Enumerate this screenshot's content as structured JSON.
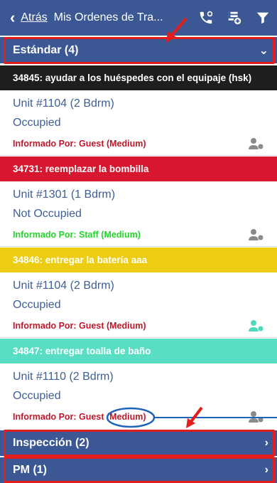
{
  "header": {
    "back_label": "Atrás",
    "title": "Mis Ordenes de Tra...",
    "icons": [
      "phone-icon",
      "add-list-icon",
      "filter-icon"
    ]
  },
  "sections": {
    "standard": {
      "label": "Estándar (4)"
    },
    "inspection": {
      "label": "Inspección (2)"
    },
    "pm": {
      "label": "PM (1)"
    }
  },
  "work_orders": [
    {
      "header": "34845: ayudar a los huéspedes con el equipaje (hsk)",
      "header_bg": "#1e1e1e",
      "header_color": "#ffffff",
      "unit": "Unit #1104 (2 Bdrm)",
      "status": "Occupied",
      "reported": "Informado Por: Guest  (Medium)",
      "reported_color": "#c0182a",
      "icon_color": "#8a8a8a"
    },
    {
      "header": "34731: reemplazar la bombilla",
      "header_bg": "#d7172f",
      "header_color": "#ffffff",
      "unit": "Unit #1301 (1 Bdrm)",
      "status": "Not Occupied",
      "reported": "Informado Por: Staff  (Medium)",
      "reported_color": "#22d42a",
      "icon_color": "#8a8a8a"
    },
    {
      "header": "34846: entregar la batería aaa",
      "header_bg": "#eccd13",
      "header_color": "#ffffff",
      "unit": "Unit #1104 (2 Bdrm)",
      "status": "Occupied",
      "reported": "Informado Por: Guest  (Medium)",
      "reported_color": "#c0182a",
      "icon_color": "#4fd8bd"
    },
    {
      "header": "34847: entregar toalla de baño",
      "header_bg": "#59dec3",
      "header_color": "#ffffff",
      "unit": "Unit #1110 (2 Bdrm)",
      "status": "Occupied",
      "reported": "Informado Por: Guest  (Medium)",
      "reported_color": "#c0182a",
      "icon_color": "#8a8a8a"
    }
  ],
  "colors": {
    "primary": "#3b5894",
    "annotation_red": "#e11d1d",
    "annotation_blue": "#1f63b8",
    "unit_text": "#3e5f94"
  }
}
